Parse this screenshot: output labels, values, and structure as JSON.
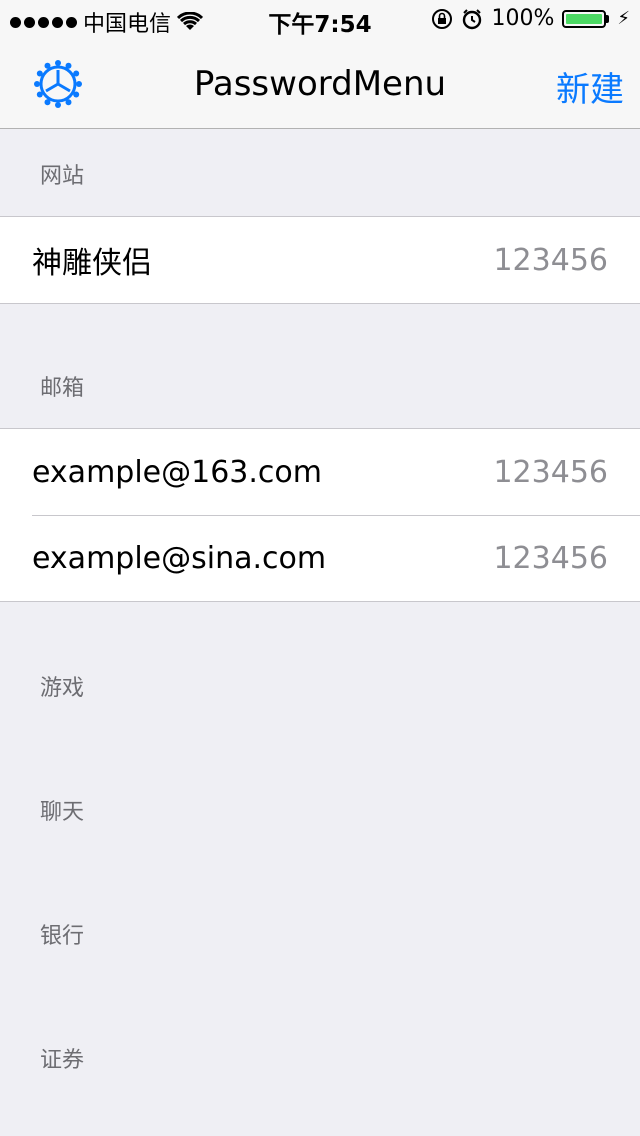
{
  "status_bar": {
    "carrier": "中国电信",
    "time": "下午7:54",
    "battery": "100%",
    "battery_level": 1.0,
    "icons": [
      "signal-dots-icon",
      "wifi-icon",
      "orientation-lock-icon",
      "alarm-icon",
      "battery-icon",
      "charging-bolt-icon"
    ]
  },
  "navbar": {
    "title": "PasswordMenu",
    "left_icon": "gear-icon",
    "right_label": "新建",
    "accent": "#0a7aff"
  },
  "sections": [
    {
      "header": "网站",
      "rows": [
        {
          "title": "神雕侠侣",
          "value": "123456"
        }
      ]
    },
    {
      "header": "邮箱",
      "rows": [
        {
          "title": "example@163.com",
          "value": "123456"
        },
        {
          "title": "example@sina.com",
          "value": "123456"
        }
      ]
    },
    {
      "header": "游戏",
      "rows": []
    },
    {
      "header": "聊天",
      "rows": []
    },
    {
      "header": "银行",
      "rows": []
    },
    {
      "header": "证券",
      "rows": []
    }
  ]
}
